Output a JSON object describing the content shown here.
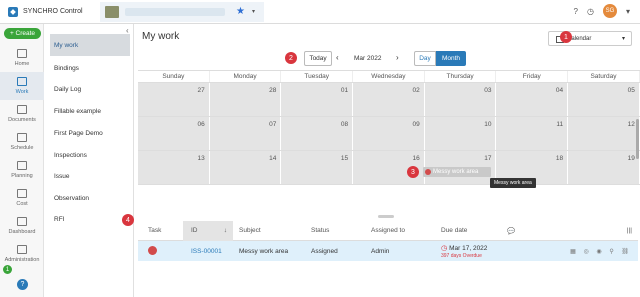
{
  "app": {
    "title": "SYNCHRO Control",
    "avatar_initials": "SG"
  },
  "rail": {
    "create_label": "+ Create",
    "items": [
      {
        "label": "Home"
      },
      {
        "label": "Work"
      },
      {
        "label": "Documents"
      },
      {
        "label": "Schedule"
      },
      {
        "label": "Planning"
      },
      {
        "label": "Cost"
      },
      {
        "label": "Dashboard"
      },
      {
        "label": "Administration"
      }
    ],
    "active": "Work",
    "help_label": "?",
    "badge": "1"
  },
  "subnav": {
    "items": [
      "My work",
      "Bindings",
      "Daily Log",
      "Fillable example",
      "First Page Demo",
      "Inspections",
      "Issue",
      "Observation",
      "RFI"
    ],
    "active": "My work"
  },
  "main": {
    "title": "My work",
    "view_button": "Calendar",
    "today_label": "Today",
    "month_label": "Mar 2022",
    "day_label": "Day",
    "month_view_label": "Month"
  },
  "calendar": {
    "weekdays": [
      "Sunday",
      "Monday",
      "Tuesday",
      "Wednesday",
      "Thursday",
      "Friday",
      "Saturday"
    ],
    "weeks": [
      [
        "27",
        "28",
        "01",
        "02",
        "03",
        "04",
        "05"
      ],
      [
        "06",
        "07",
        "08",
        "09",
        "10",
        "11",
        "12"
      ],
      [
        "13",
        "14",
        "15",
        "16",
        "17",
        "18",
        "19"
      ]
    ],
    "event_label": "Messy work area",
    "tooltip": "Messy work area"
  },
  "callouts": [
    "1",
    "2",
    "3",
    "4"
  ],
  "table": {
    "headers": {
      "task": "Task",
      "id": "ID",
      "subject": "Subject",
      "status": "Status",
      "assigned": "Assigned to",
      "due": "Due date"
    },
    "rows": [
      {
        "id": "ISS-00001",
        "subject": "Messy work area",
        "status": "Assigned",
        "assigned": "Admin",
        "due": "Mar 17, 2022",
        "overdue": "397 days Overdue"
      }
    ]
  }
}
